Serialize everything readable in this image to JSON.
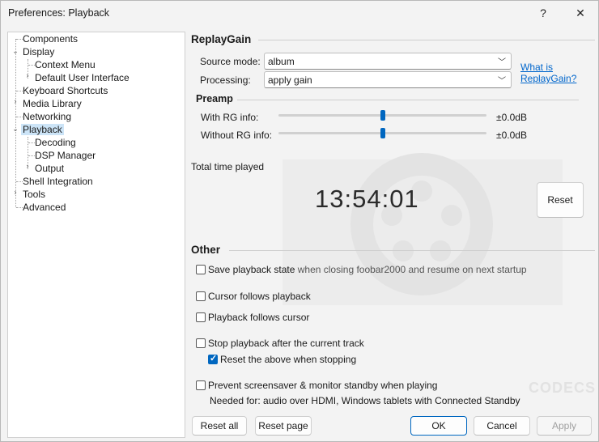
{
  "window": {
    "title": "Preferences: Playback",
    "help_label": "?",
    "close_label": "✕"
  },
  "tree": {
    "items": [
      {
        "label": "Components"
      },
      {
        "label": "Display"
      },
      {
        "label": "Context Menu"
      },
      {
        "label": "Default User Interface"
      },
      {
        "label": "Keyboard Shortcuts"
      },
      {
        "label": "Media Library"
      },
      {
        "label": "Networking"
      },
      {
        "label": "Playback"
      },
      {
        "label": "Decoding"
      },
      {
        "label": "DSP Manager"
      },
      {
        "label": "Output"
      },
      {
        "label": "Shell Integration"
      },
      {
        "label": "Tools"
      },
      {
        "label": "Advanced"
      }
    ]
  },
  "replaygain": {
    "title": "ReplayGain",
    "source_mode_label": "Source mode:",
    "source_mode_value": "album",
    "processing_label": "Processing:",
    "processing_value": "apply gain",
    "help_link_line1": "What is",
    "help_link_line2": "ReplayGain?"
  },
  "preamp": {
    "title": "Preamp",
    "with_rg_label": "With RG info:",
    "with_rg_value": "±0.0dB",
    "with_rg_level": 0.5,
    "without_rg_label": "Without RG info:",
    "without_rg_value": "±0.0dB",
    "without_rg_level": 0.5
  },
  "total_time": {
    "label": "Total time played",
    "value": "13:54:01",
    "reset_label": "Reset"
  },
  "other": {
    "title": "Other",
    "save_state_strong": "Save playback state",
    "save_state_rest": " when closing foobar2000 and resume on next startup",
    "save_state_checked": false,
    "cursor_follows": "Cursor follows playback",
    "cursor_follows_checked": false,
    "playback_follows": "Playback follows cursor",
    "playback_follows_checked": false,
    "stop_after": "Stop playback after the current track",
    "stop_after_checked": false,
    "reset_above": "Reset the above when stopping",
    "reset_above_checked": true,
    "prevent_screensaver": "Prevent screensaver & monitor standby when playing",
    "prevent_screensaver_checked": false,
    "needed_for": "Needed for: audio over HDMI, Windows tablets with Connected Standby"
  },
  "footer": {
    "reset_all": "Reset all",
    "reset_page": "Reset page",
    "ok": "OK",
    "cancel": "Cancel",
    "apply": "Apply"
  },
  "watermark": {
    "brand": "CODECS"
  },
  "colors": {
    "accent": "#0067c0",
    "selection": "#cce4f7",
    "link": "#0066cc"
  }
}
